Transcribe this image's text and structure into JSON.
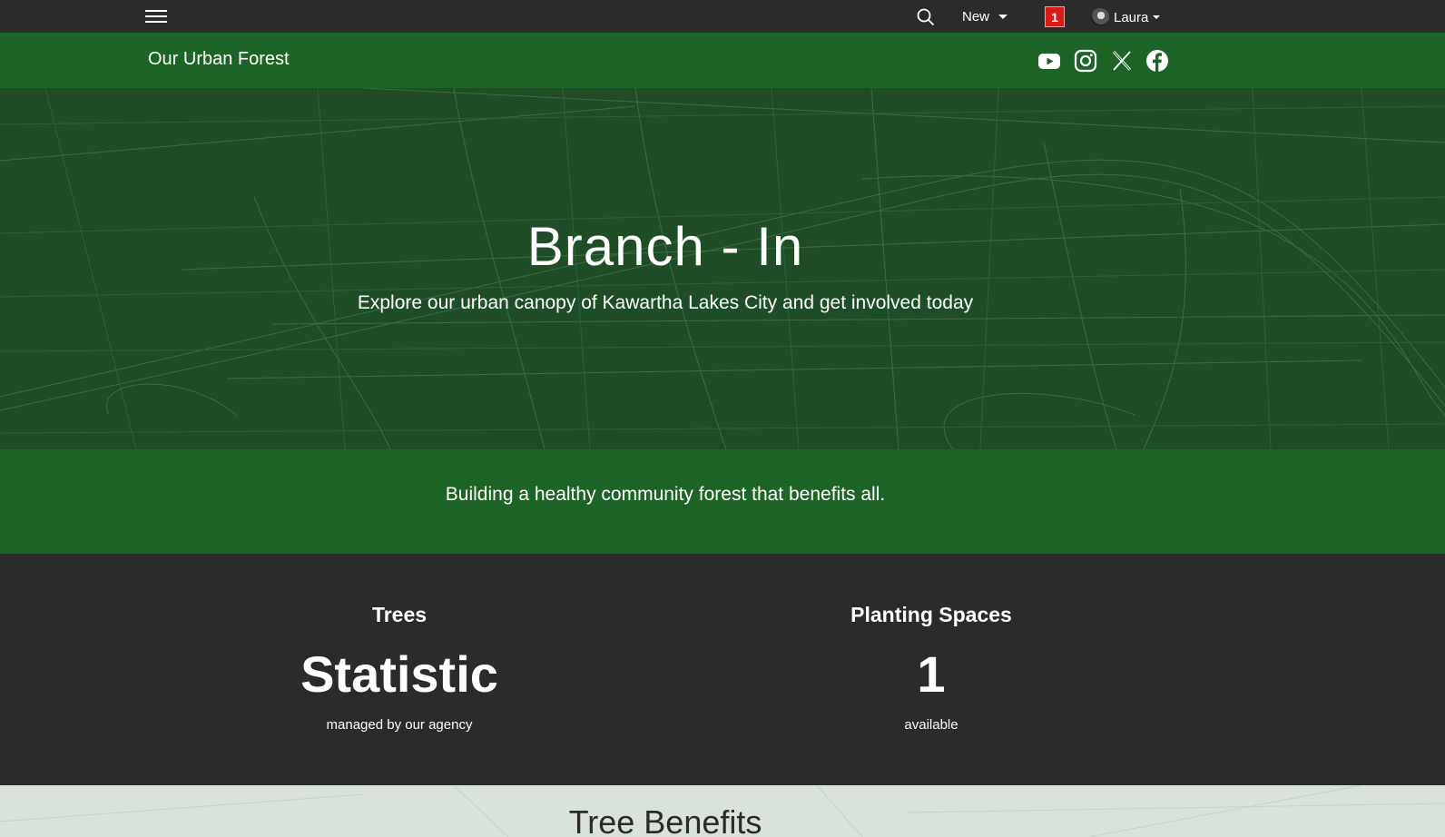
{
  "topbar": {
    "menu_icon": "hamburger-menu-icon",
    "search_icon": "search-icon",
    "new_label": "New",
    "notification_count": "1",
    "user_name": "Laura"
  },
  "header": {
    "site_title": "Our Urban Forest",
    "social": [
      "youtube-icon",
      "instagram-icon",
      "x-icon",
      "facebook-icon"
    ]
  },
  "hero": {
    "title": "Branch - In",
    "subtitle": "Explore our urban canopy of Kawartha Lakes City and get involved today"
  },
  "tagline": "Building a healthy community forest that benefits all.",
  "stats": [
    {
      "label": "Trees",
      "value": "Statistic",
      "note": "managed by our agency"
    },
    {
      "label": "Planting Spaces",
      "value": "1",
      "note": "available"
    }
  ],
  "benefits": {
    "title": "Tree Benefits"
  },
  "colors": {
    "dark": "#2b2b2b",
    "green": "#1c6527",
    "hero_green": "#1f4f28",
    "light": "#d9e3da",
    "badge": "#d81a1a"
  }
}
